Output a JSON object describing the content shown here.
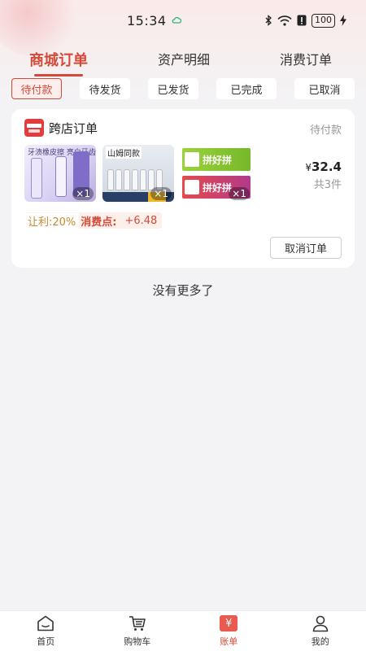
{
  "status_bar": {
    "time": "15:34",
    "battery": "100"
  },
  "main_tabs": [
    {
      "label": "商城订单",
      "active": true
    },
    {
      "label": "资产明细",
      "active": false
    },
    {
      "label": "消费订单",
      "active": false
    }
  ],
  "filters": [
    {
      "label": "待付款",
      "active": true
    },
    {
      "label": "待发货",
      "active": false
    },
    {
      "label": "已发货",
      "active": false
    },
    {
      "label": "已完成",
      "active": false
    },
    {
      "label": "已取消",
      "active": false
    }
  ],
  "order": {
    "shop_name": "跨店订单",
    "status": "待付款",
    "items": [
      {
        "caption": "牙渍橡皮擦 亮白牙齿",
        "qty": "×1"
      },
      {
        "caption": "山姆同款",
        "qty": "×1"
      },
      {
        "caption": "拼好拼",
        "qty": "×1"
      }
    ],
    "price_symbol": "¥",
    "price": "32.4",
    "count": "共3件",
    "profit_label": "让利:20%",
    "points_label": "消费点:",
    "points_value": "+6.48",
    "cancel_label": "取消订单"
  },
  "no_more_text": "没有更多了",
  "bottom_nav": [
    {
      "label": "首页",
      "icon": "home-icon",
      "active": false
    },
    {
      "label": "购物车",
      "icon": "cart-icon",
      "active": false
    },
    {
      "label": "账单",
      "icon": "bill-icon",
      "active": true,
      "glyph": "¥"
    },
    {
      "label": "我的",
      "icon": "user-icon",
      "active": false
    }
  ],
  "colors": {
    "accent": "#d34a3a",
    "background": "#f3f3f6"
  }
}
